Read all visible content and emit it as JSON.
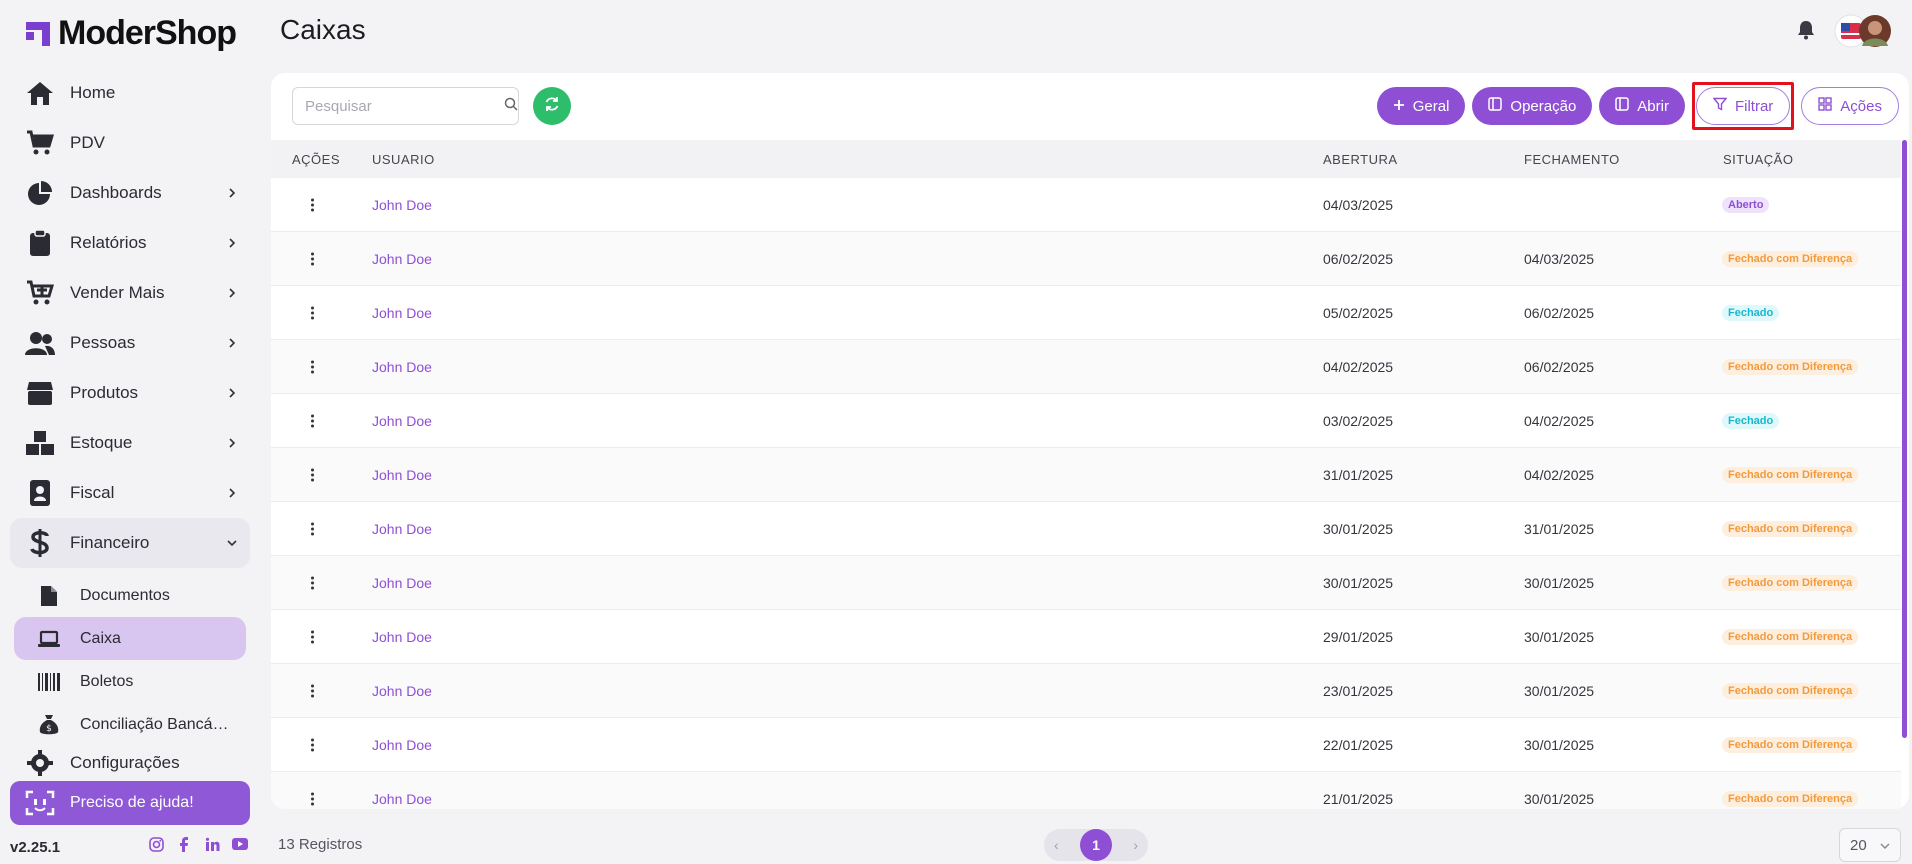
{
  "brand": {
    "name": "ModerShop",
    "version": "v2.25.1"
  },
  "nav": {
    "items": [
      {
        "label": "Home"
      },
      {
        "label": "PDV"
      },
      {
        "label": "Dashboards"
      },
      {
        "label": "Relatórios"
      },
      {
        "label": "Vender Mais"
      },
      {
        "label": "Pessoas"
      },
      {
        "label": "Produtos"
      },
      {
        "label": "Estoque"
      },
      {
        "label": "Fiscal"
      },
      {
        "label": "Financeiro"
      }
    ],
    "sub_items": [
      {
        "label": "Documentos"
      },
      {
        "label": "Caixa"
      },
      {
        "label": "Boletos"
      },
      {
        "label": "Conciliação Bancária"
      }
    ],
    "settings_label": "Configurações",
    "help_label": "Preciso de ajuda!"
  },
  "header": {
    "title": "Caixas"
  },
  "toolbar": {
    "search_placeholder": "Pesquisar",
    "geral": "Geral",
    "operacao": "Operação",
    "abrir": "Abrir",
    "filtrar": "Filtrar",
    "acoes": "Ações"
  },
  "table": {
    "headers": {
      "acoes": "AÇÕES",
      "usuario": "USUARIO",
      "abertura": "ABERTURA",
      "fechamento": "FECHAMENTO",
      "situacao": "SITUAÇÃO"
    },
    "rows": [
      {
        "user": "John Doe",
        "abertura": "04/03/2025",
        "fechamento": "",
        "status": "Aberto",
        "kind": "open"
      },
      {
        "user": "John Doe",
        "abertura": "06/02/2025",
        "fechamento": "04/03/2025",
        "status": "Fechado com Diferença",
        "kind": "diff"
      },
      {
        "user": "John Doe",
        "abertura": "05/02/2025",
        "fechamento": "06/02/2025",
        "status": "Fechado",
        "kind": "closed"
      },
      {
        "user": "John Doe",
        "abertura": "04/02/2025",
        "fechamento": "06/02/2025",
        "status": "Fechado com Diferença",
        "kind": "diff"
      },
      {
        "user": "John Doe",
        "abertura": "03/02/2025",
        "fechamento": "04/02/2025",
        "status": "Fechado",
        "kind": "closed"
      },
      {
        "user": "John Doe",
        "abertura": "31/01/2025",
        "fechamento": "04/02/2025",
        "status": "Fechado com Diferença",
        "kind": "diff"
      },
      {
        "user": "John Doe",
        "abertura": "30/01/2025",
        "fechamento": "31/01/2025",
        "status": "Fechado com Diferença",
        "kind": "diff"
      },
      {
        "user": "John Doe",
        "abertura": "30/01/2025",
        "fechamento": "30/01/2025",
        "status": "Fechado com Diferença",
        "kind": "diff"
      },
      {
        "user": "John Doe",
        "abertura": "29/01/2025",
        "fechamento": "30/01/2025",
        "status": "Fechado com Diferença",
        "kind": "diff"
      },
      {
        "user": "John Doe",
        "abertura": "23/01/2025",
        "fechamento": "30/01/2025",
        "status": "Fechado com Diferença",
        "kind": "diff"
      },
      {
        "user": "John Doe",
        "abertura": "22/01/2025",
        "fechamento": "30/01/2025",
        "status": "Fechado com Diferença",
        "kind": "diff"
      },
      {
        "user": "John Doe",
        "abertura": "21/01/2025",
        "fechamento": "30/01/2025",
        "status": "Fechado com Diferença",
        "kind": "diff"
      }
    ]
  },
  "badge_colors": {
    "open": {
      "bg": "#efe3fb",
      "fg": "#8e4fd4"
    },
    "diff": {
      "bg": "#fdeede",
      "fg": "#f29a3e"
    },
    "closed": {
      "bg": "#dff8fb",
      "fg": "#17b8cf"
    }
  },
  "footer": {
    "records": "13 Registros",
    "page": "1",
    "per_page": "20"
  },
  "colors": {
    "accent": "#8e4fd4",
    "refresh": "#2ebd6b",
    "highlight": "#e4101b"
  }
}
